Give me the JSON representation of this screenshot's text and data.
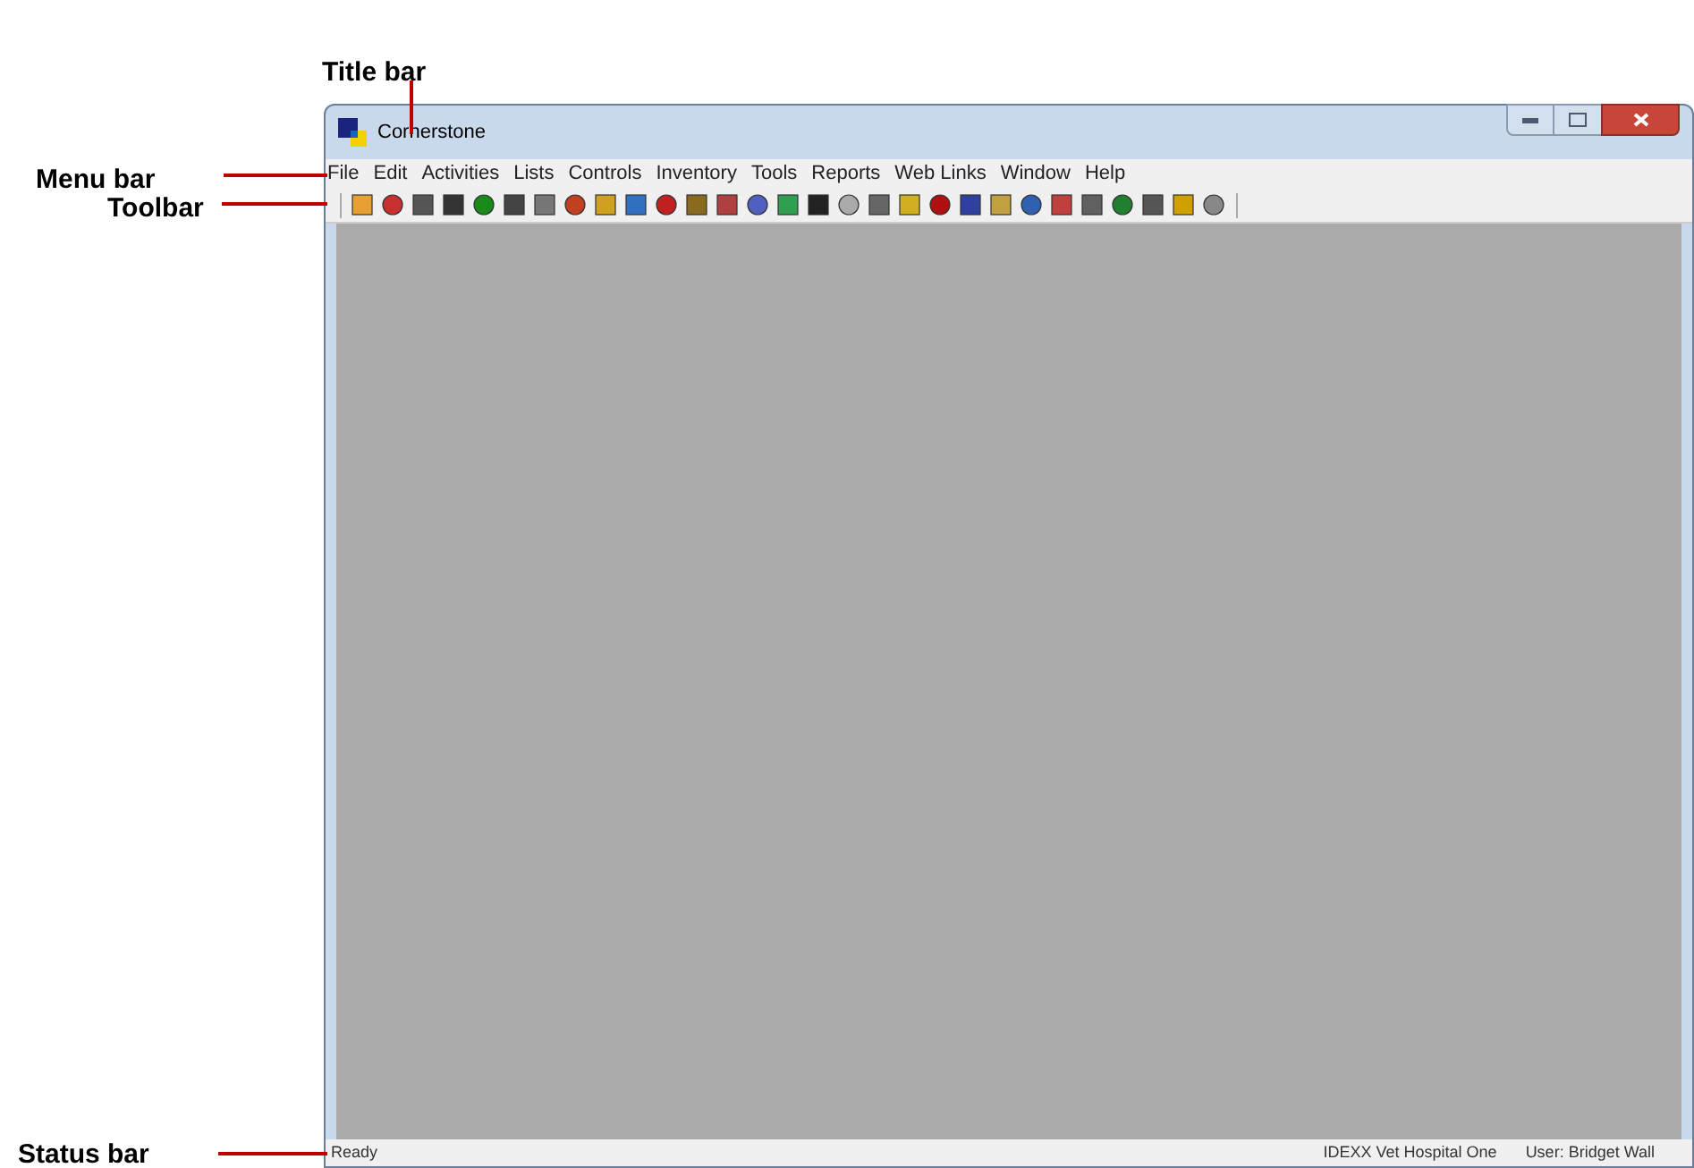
{
  "callouts": [
    {
      "label": "Title bar",
      "kind": "title"
    },
    {
      "label": "Menu bar",
      "kind": "menu"
    },
    {
      "label": "Toolbar",
      "kind": "toolbar"
    },
    {
      "label": "Status bar",
      "kind": "status"
    }
  ],
  "window": {
    "title": "Cornerstone"
  },
  "menu_bar": [
    "File",
    "Edit",
    "Activities",
    "Lists",
    "Controls",
    "Inventory",
    "Tools",
    "Reports",
    "Web Links",
    "Window",
    "Help"
  ],
  "status_bar": {
    "message": "Ready",
    "hospital": "IDEXX Vet Hospital One",
    "user": "User: Bridget Wall"
  }
}
